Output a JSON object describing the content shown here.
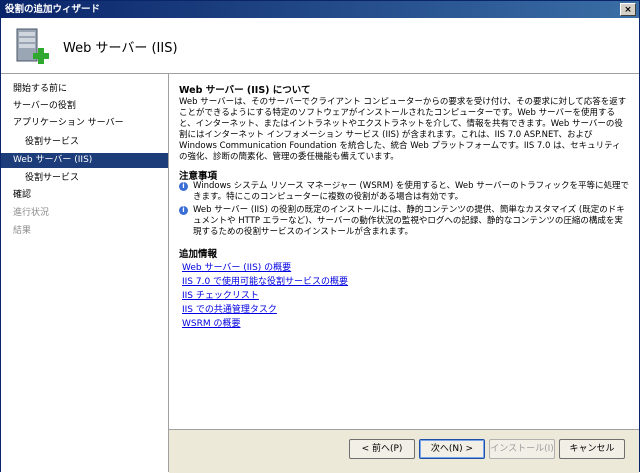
{
  "window": {
    "title": "役割の追加ウィザード",
    "close_label": "×"
  },
  "header": {
    "title": "Web サーバー (IIS)"
  },
  "sidebar": {
    "items": [
      {
        "label": "開始する前に"
      },
      {
        "label": "サーバーの役割"
      },
      {
        "label": "アプリケーション サーバー"
      },
      {
        "label": "役割サービス"
      },
      {
        "label": "Web サーバー (IIS)"
      },
      {
        "label": "役割サービス"
      },
      {
        "label": "確認"
      },
      {
        "label": "進行状況"
      },
      {
        "label": "結果"
      }
    ]
  },
  "content": {
    "about_heading": "Web サーバー (IIS) について",
    "about_text": "Web サーバーは、そのサーバーでクライアント コンピューターからの要求を受け付け、その要求に対して応答を返すことができるようにする特定のソフトウェアがインストールされたコンピューターです。Web サーバーを使用すると、インターネット、またはイントラネットやエクストラネットを介して、情報を共有できます。Web サーバーの役割にはインターネット インフォメーション サービス (IIS) が含まれます。これは、IIS 7.0 ASP.NET、および Windows Communication Foundation を統合した、統合 Web プラットフォームです。IIS 7.0 は、セキュリティの強化、診断の簡素化、管理の委任機能も備えています。",
    "notes_heading": "注意事項",
    "notes": [
      {
        "text": "Windows システム リソース マネージャー (WSRM) を使用すると、Web サーバーのトラフィックを平等に処理できます。特にこのコンピューターに複数の役割がある場合は有効です。"
      },
      {
        "text": "Web サーバー (IIS) の役割の既定のインストールには、静的コンテンツの提供、簡単なカスタマイズ (既定のドキュメントや HTTP エラーなど)、サーバーの動作状況の監視やログへの記録、静的なコンテンツの圧縮の構成を実現するための役割サービスのインストールが含まれます。"
      }
    ],
    "info_heading": "追加情報",
    "links": [
      {
        "label": "Web サーバー (IIS) の概要"
      },
      {
        "label": "IIS 7.0 で使用可能な役割サービスの概要"
      },
      {
        "label": "IIS チェックリスト"
      },
      {
        "label": "IIS での共通管理タスク"
      },
      {
        "label": "WSRM の概要"
      }
    ]
  },
  "buttons": {
    "prev": "< 前へ(P)",
    "next": "次へ(N) >",
    "install": "インストール(I)",
    "cancel": "キャンセル"
  },
  "colors": {
    "selected": "#1c3d7a",
    "link": "#0000e0",
    "titlebar": "#0a246a"
  }
}
